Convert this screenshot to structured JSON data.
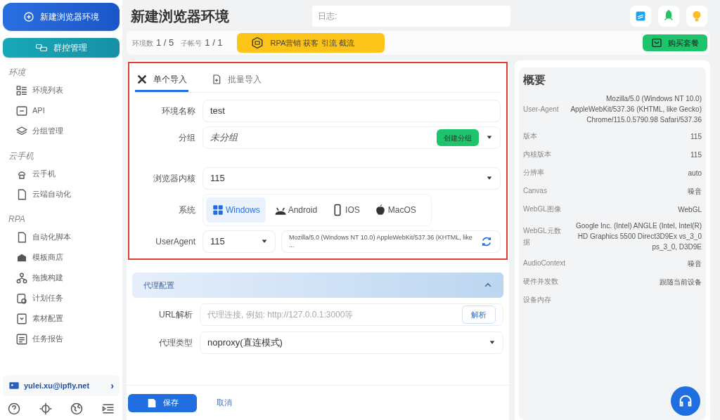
{
  "sidebar": {
    "new_button": "新建浏览器环境",
    "group_button": "群控管理",
    "sections": [
      {
        "title": "环境",
        "items": [
          {
            "label": "环境列表"
          },
          {
            "label": "API"
          },
          {
            "label": "分组管理"
          }
        ]
      },
      {
        "title": "云手机",
        "items": [
          {
            "label": "云手机"
          },
          {
            "label": "云端自动化"
          }
        ]
      },
      {
        "title": "RPA",
        "items": [
          {
            "label": "自动化脚本"
          },
          {
            "label": "模板商店"
          },
          {
            "label": "拖拽构建"
          },
          {
            "label": "计划任务"
          },
          {
            "label": "素材配置"
          },
          {
            "label": "任务报告"
          }
        ]
      }
    ],
    "account": {
      "email": "yulei.xu@ipfly.net",
      "chevron": "›"
    }
  },
  "header": {
    "title": "新建浏览器环境",
    "log_placeholder": "日志:"
  },
  "stats": {
    "env_label": "环境数",
    "env_value": "1 / 5",
    "sub_label": "子帐号",
    "sub_value": "1 / 1",
    "promo": "RPA营销 获客 引流 截流",
    "buy": "购买套餐"
  },
  "tabs": [
    {
      "label": "单个导入",
      "selected": true
    },
    {
      "label": "批量导入",
      "selected": false
    }
  ],
  "form": {
    "name_label": "环境名称",
    "name_value": "test",
    "group_label": "分组",
    "group_value": "未分组",
    "create_group": "创建分组",
    "kernel_label": "浏览器内核",
    "kernel_value": "115",
    "os_label": "系统",
    "os_options": [
      {
        "label": "Windows",
        "selected": true
      },
      {
        "label": "Android",
        "selected": false
      },
      {
        "label": "IOS",
        "selected": false
      },
      {
        "label": "MacOS",
        "selected": false
      }
    ],
    "ua_label": "UserAgent",
    "ua_version": "115",
    "ua_value": "Mozilla/5.0 (Windows NT 10.0) AppleWebKit/537.36 (KHTML, like ..."
  },
  "proxy": {
    "title": "代理配置",
    "expanded": true,
    "url_label": "URL解析",
    "url_placeholder": "代理连接, 例如: http://127.0.0.1:3000等",
    "parse": "解析",
    "type_label": "代理类型",
    "type_value": "noproxy(直连模式)"
  },
  "footer": {
    "save": "保存",
    "cancel": "取消"
  },
  "summary": {
    "title": "概要",
    "rows": [
      {
        "label": "User-Agent",
        "value": "Mozilla/5.0 (Windows NT 10.0) AppleWebKit/537.36 (KHTML, like Gecko) Chrome/115.0.5790.98 Safari/537.36"
      },
      {
        "label": "版本",
        "value": "115"
      },
      {
        "label": "内核版本",
        "value": "115"
      },
      {
        "label": "分辨率",
        "value": "auto"
      },
      {
        "label": "Canvas",
        "value": "噪音"
      },
      {
        "label": "WebGL图像",
        "value": "WebGL"
      },
      {
        "label": "WebGL元数据",
        "value": "Google Inc. (Intel) ANGLE (Intel, Intel(R) HD Graphics 5500 Direct3D9Ex vs_3_0 ps_3_0, D3D9E"
      },
      {
        "label": "AudioContext",
        "value": "噪音"
      },
      {
        "label": "硬件并发数",
        "value": "跟随当前设备"
      },
      {
        "label": "设备内存"
      }
    ]
  }
}
